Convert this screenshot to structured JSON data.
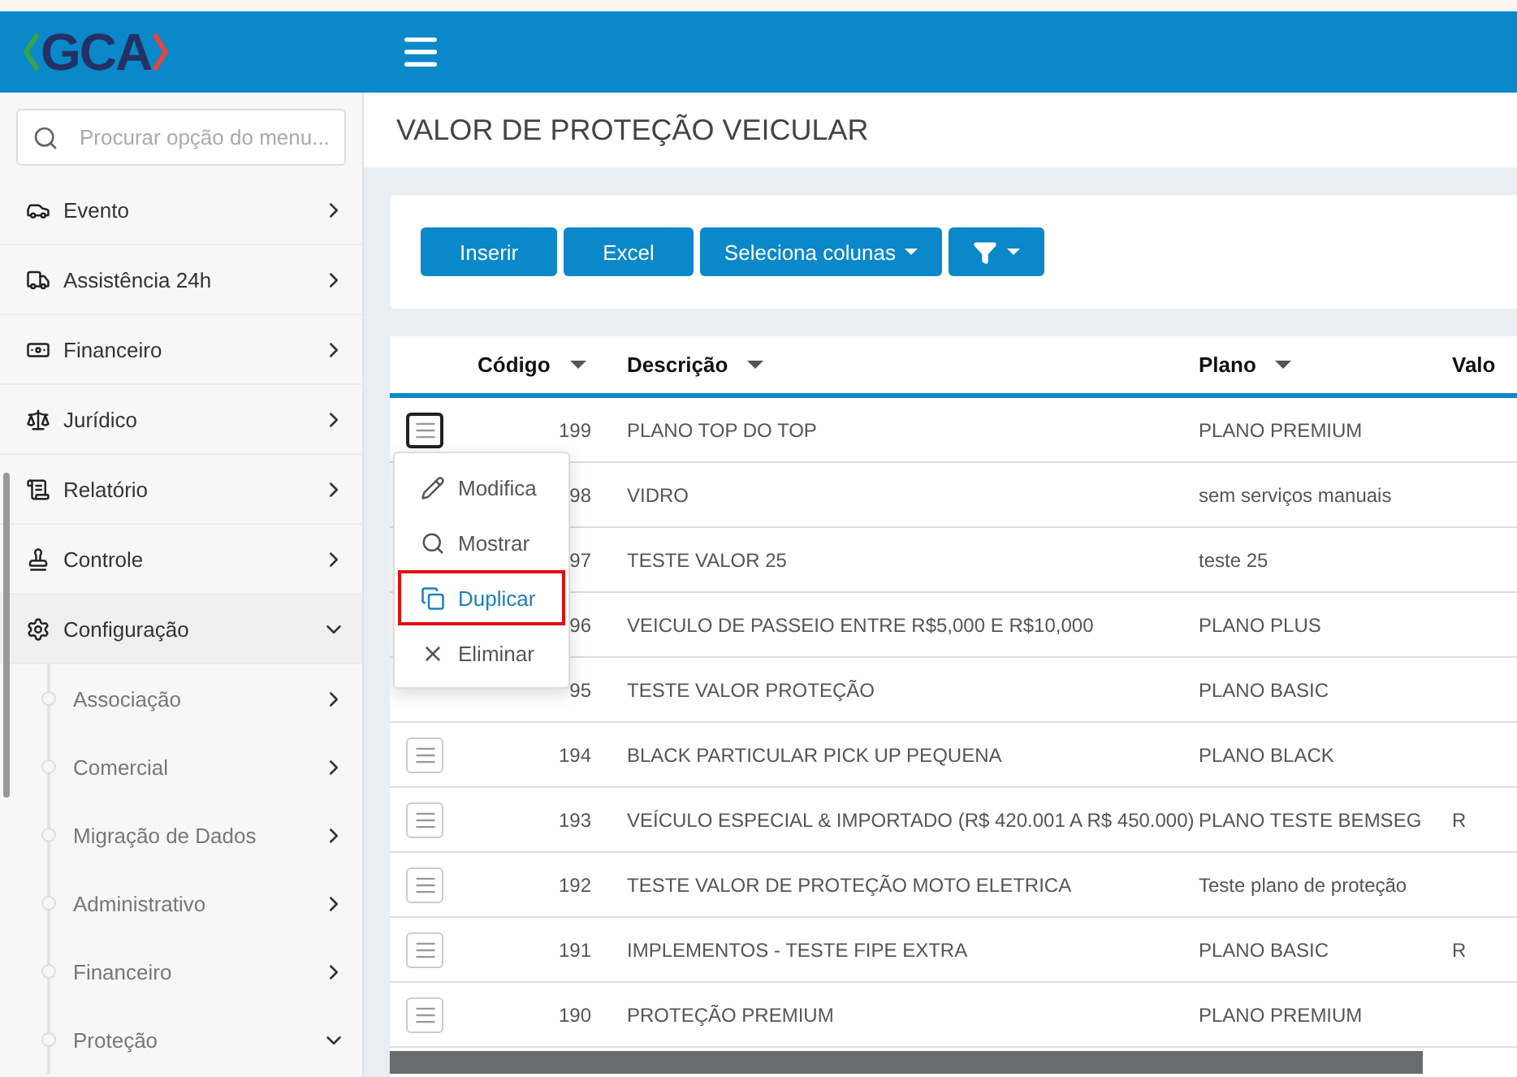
{
  "header": {
    "logo": "GCA"
  },
  "sidebar": {
    "search": {
      "placeholder": "Procurar opção do menu..."
    },
    "items": [
      {
        "label": "Evento",
        "expanded": false
      },
      {
        "label": "Assistência 24h",
        "expanded": false
      },
      {
        "label": "Financeiro",
        "expanded": false
      },
      {
        "label": "Jurídico",
        "expanded": false
      },
      {
        "label": "Relatório",
        "expanded": false
      },
      {
        "label": "Controle",
        "expanded": false
      },
      {
        "label": "Configuração",
        "expanded": true,
        "children": [
          {
            "label": "Associação",
            "expanded": false
          },
          {
            "label": "Comercial",
            "expanded": false
          },
          {
            "label": "Migração de Dados",
            "expanded": false
          },
          {
            "label": "Administrativo",
            "expanded": false
          },
          {
            "label": "Financeiro",
            "expanded": false
          },
          {
            "label": "Proteção",
            "expanded": true
          }
        ]
      }
    ]
  },
  "page": {
    "title": "VALOR DE PROTEÇÃO VEICULAR"
  },
  "toolbar": [
    {
      "label": "Inserir",
      "kind": "plain"
    },
    {
      "label": "Excel",
      "kind": "plain"
    },
    {
      "label": "Seleciona colunas",
      "kind": "dropdown"
    },
    {
      "kind": "filter"
    }
  ],
  "table": {
    "columns": [
      {
        "label": "Código",
        "sortable": true
      },
      {
        "label": "Descrição",
        "sortable": true
      },
      {
        "label": "Plano",
        "sortable": true
      },
      {
        "label": "Valo",
        "sortable": false
      }
    ],
    "rows": [
      {
        "menu_open": true,
        "cells": [
          "199",
          "PLANO TOP DO TOP",
          "PLANO PREMIUM",
          ""
        ]
      },
      {
        "menu_open": false,
        "cells": [
          "98",
          "VIDRO",
          "sem serviços manuais",
          ""
        ]
      },
      {
        "menu_open": false,
        "cells": [
          "97",
          "TESTE VALOR 25",
          "teste 25",
          ""
        ]
      },
      {
        "menu_open": false,
        "cells": [
          "96",
          "VEICULO DE PASSEIO ENTRE R$5,000 E R$10,000",
          "PLANO PLUS",
          ""
        ]
      },
      {
        "menu_open": false,
        "cells": [
          "95",
          "TESTE VALOR PROTEÇÃO",
          "PLANO BASIC",
          ""
        ]
      },
      {
        "menu_open": false,
        "cells": [
          "194",
          "BLACK PARTICULAR PICK UP PEQUENA",
          "PLANO BLACK",
          ""
        ]
      },
      {
        "menu_open": false,
        "cells": [
          "193",
          "VEÍCULO ESPECIAL & IMPORTADO (R$ 420.001 A R$ 450.000)",
          "PLANO TESTE BEMSEG",
          "R"
        ]
      },
      {
        "menu_open": false,
        "cells": [
          "192",
          "TESTE VALOR DE PROTEÇÃO MOTO ELETRICA",
          "Teste plano de proteção",
          ""
        ]
      },
      {
        "menu_open": false,
        "cells": [
          "191",
          "IMPLEMENTOS - TESTE FIPE EXTRA",
          "PLANO BASIC",
          "R"
        ]
      },
      {
        "menu_open": false,
        "cells": [
          "190",
          "PROTEÇÃO PREMIUM",
          "PLANO PREMIUM",
          ""
        ]
      }
    ]
  },
  "row_menu": [
    {
      "label": "Modifica",
      "selected": false
    },
    {
      "label": "Mostrar",
      "selected": false
    },
    {
      "label": "Duplicar",
      "selected": true
    },
    {
      "label": "Eliminar",
      "selected": false
    }
  ]
}
